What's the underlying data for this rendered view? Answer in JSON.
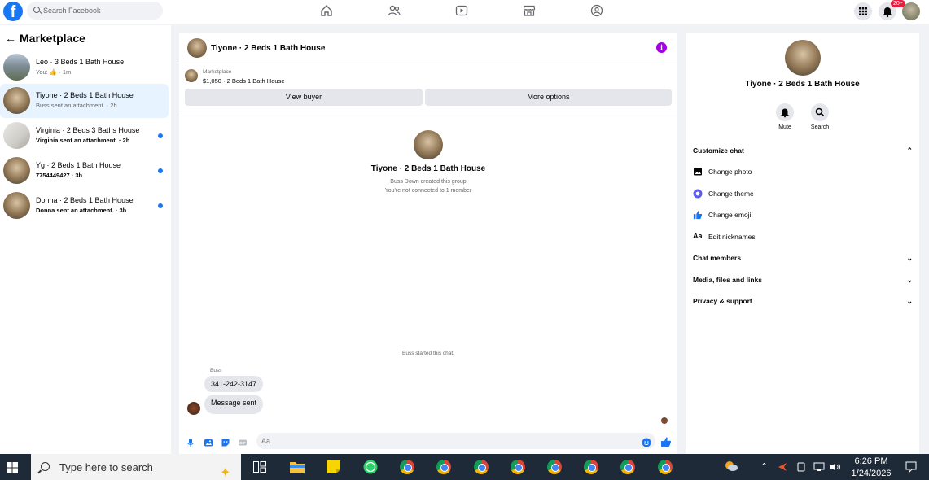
{
  "topbar": {
    "search_placeholder": "Search Facebook",
    "notifications_badge": "20+"
  },
  "left": {
    "title": "Marketplace",
    "conversations": [
      {
        "title": "Leo · 3 Beds 1 Bath House",
        "subtitle": "You: 👍 · 1m",
        "unread": false,
        "active": false
      },
      {
        "title": "Tiyone · 2 Beds 1 Bath House",
        "subtitle": "Buss sent an attachment. · 2h",
        "unread": false,
        "active": true
      },
      {
        "title": "Virginia · 2 Beds 3 Baths House",
        "subtitle": "Virginia sent an attachment. · 2h",
        "unread": true,
        "active": false
      },
      {
        "title": "Yg · 2 Beds 1 Bath House",
        "subtitle": "7754449427 · 3h",
        "unread": true,
        "active": false
      },
      {
        "title": "Donna · 2 Beds 1 Bath House",
        "subtitle": "Donna sent an attachment. · 3h",
        "unread": true,
        "active": false
      }
    ]
  },
  "chat": {
    "title": "Tiyone · 2 Beds 1 Bath House",
    "listing_label": "Marketplace",
    "listing_price": "$1,050 · 2 Beds 1 Bath House",
    "view_buyer": "View buyer",
    "more_options": "More options",
    "group_name": "Tiyone · 2 Beds 1 Bath House",
    "created_text": "Buss Down created this group",
    "not_connected": "You're not connected to 1 member",
    "started_text": "Buss started this chat.",
    "sender_name": "Buss",
    "messages": [
      "341-242-3147",
      "Message sent"
    ],
    "input_placeholder": "Aa"
  },
  "details": {
    "name": "Tiyone · 2 Beds 1 Bath House",
    "mute_label": "Mute",
    "search_label": "Search",
    "customize_chat": "Customize chat",
    "change_photo": "Change photo",
    "change_theme": "Change theme",
    "change_emoji": "Change emoji",
    "edit_nicknames": "Edit nicknames",
    "chat_members": "Chat members",
    "media_files_links": "Media, files and links",
    "privacy_support": "Privacy & support"
  },
  "taskbar": {
    "search_text": "Type here to search",
    "time": "6:26 PM",
    "date": "1/24/2026"
  },
  "colors": {
    "brand": "#1877f2",
    "info_purple": "#a400e6",
    "taskbar": "#1f2a38"
  }
}
